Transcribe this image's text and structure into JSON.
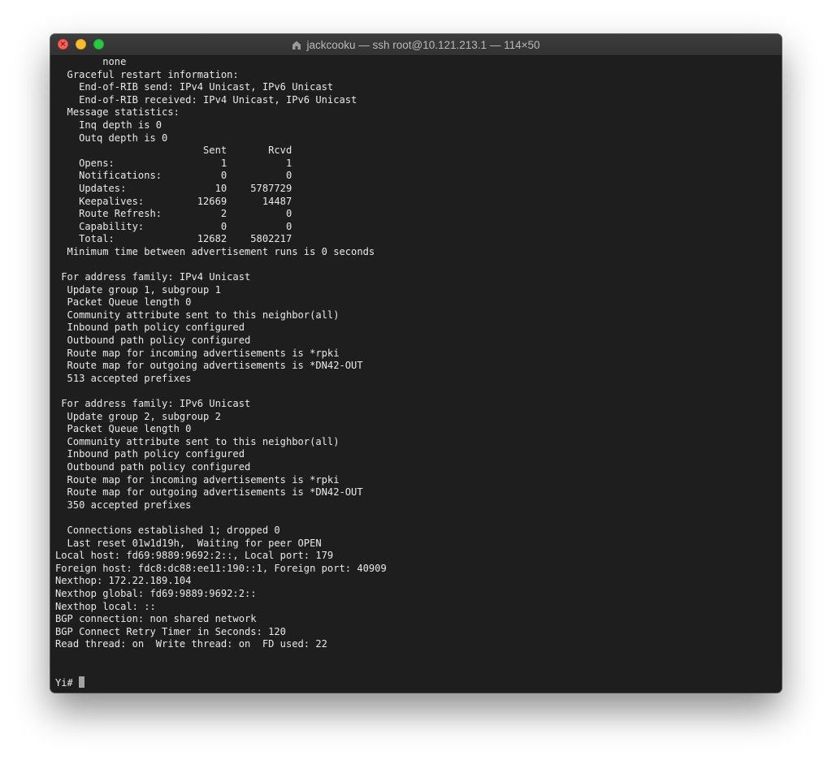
{
  "window": {
    "title": "jackcooku — ssh root@10.121.213.1 — 114×50",
    "title_icon": "home-folder-icon",
    "colors": {
      "background": "#1e1e1e",
      "text": "#e9e9e9",
      "close": "#ff5f57",
      "minimize": "#febc2e",
      "maximize": "#28c840"
    }
  },
  "terminal": {
    "lines": [
      "        none",
      "  Graceful restart information:",
      "    End-of-RIB send: IPv4 Unicast, IPv6 Unicast",
      "    End-of-RIB received: IPv4 Unicast, IPv6 Unicast",
      "  Message statistics:",
      "    Inq depth is 0",
      "    Outq depth is 0",
      "                         Sent       Rcvd",
      "    Opens:                  1          1",
      "    Notifications:          0          0",
      "    Updates:               10    5787729",
      "    Keepalives:         12669      14487",
      "    Route Refresh:          2          0",
      "    Capability:             0          0",
      "    Total:              12682    5802217",
      "  Minimum time between advertisement runs is 0 seconds",
      "",
      " For address family: IPv4 Unicast",
      "  Update group 1, subgroup 1",
      "  Packet Queue length 0",
      "  Community attribute sent to this neighbor(all)",
      "  Inbound path policy configured",
      "  Outbound path policy configured",
      "  Route map for incoming advertisements is *rpki",
      "  Route map for outgoing advertisements is *DN42-OUT",
      "  513 accepted prefixes",
      "",
      " For address family: IPv6 Unicast",
      "  Update group 2, subgroup 2",
      "  Packet Queue length 0",
      "  Community attribute sent to this neighbor(all)",
      "  Inbound path policy configured",
      "  Outbound path policy configured",
      "  Route map for incoming advertisements is *rpki",
      "  Route map for outgoing advertisements is *DN42-OUT",
      "  350 accepted prefixes",
      "",
      "  Connections established 1; dropped 0",
      "  Last reset 01w1d19h,  Waiting for peer OPEN",
      "Local host: fd69:9889:9692:2::, Local port: 179",
      "Foreign host: fdc8:dc88:ee11:190::1, Foreign port: 40909",
      "Nexthop: 172.22.189.104",
      "Nexthop global: fd69:9889:9692:2::",
      "Nexthop local: ::",
      "BGP connection: non shared network",
      "BGP Connect Retry Timer in Seconds: 120",
      "Read thread: on  Write thread: on  FD used: 22",
      "",
      ""
    ],
    "prompt": "Yi# "
  }
}
